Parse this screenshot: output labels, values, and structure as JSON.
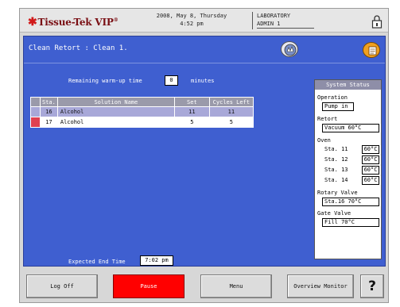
{
  "header": {
    "logo_text": "Tissue-Tek VIP",
    "date_line": "2008, May 8, Thursday",
    "time_line": "4:52 pm",
    "location": "LABORATORY",
    "user": "ADMIN 1",
    "lock_icon": "lock-icon"
  },
  "panel": {
    "title": "Clean Retort : Clean 1.",
    "warmup_label": "Remaining warm-up time",
    "warmup_value": "0",
    "warmup_unit": "minutes",
    "end_label": "Expected End Time",
    "end_value": "7:02 pm"
  },
  "table": {
    "headers": [
      "Sta.",
      "Solution Name",
      "Set",
      "Cycles Left"
    ],
    "rows": [
      {
        "sta": "16",
        "name": "Alcohol",
        "set": "11",
        "cycles": "11"
      },
      {
        "sta": "17",
        "name": "Alcohol",
        "set": "5",
        "cycles": "5"
      }
    ]
  },
  "status": {
    "title": "System Status",
    "operation_label": "Operation",
    "operation_value": "Pump in",
    "retort_label": "Retort",
    "retort_value": "Vacuum  60°C",
    "oven_label": "Oven",
    "oven": [
      {
        "sta": "Sta. 11",
        "temp": "60°C"
      },
      {
        "sta": "Sta. 12",
        "temp": "60°C"
      },
      {
        "sta": "Sta. 13",
        "temp": "60°C"
      },
      {
        "sta": "Sta. 14",
        "temp": "60°C"
      }
    ],
    "rotary_label": "Rotary Valve",
    "rotary_value": "Sta.16  70°C",
    "gate_label": "Gate Valve",
    "gate_value": "Fill  70°C"
  },
  "buttons": {
    "logoff": "Log Off",
    "pause": "Pause",
    "menu": "Menu",
    "overview": "Overview Monitor",
    "help": "?"
  },
  "colors": {
    "panel_blue": "#3f5fd0",
    "pause_red": "#ff0000",
    "row_selected": "#a8a8d8",
    "row_marker": "#e04050"
  }
}
